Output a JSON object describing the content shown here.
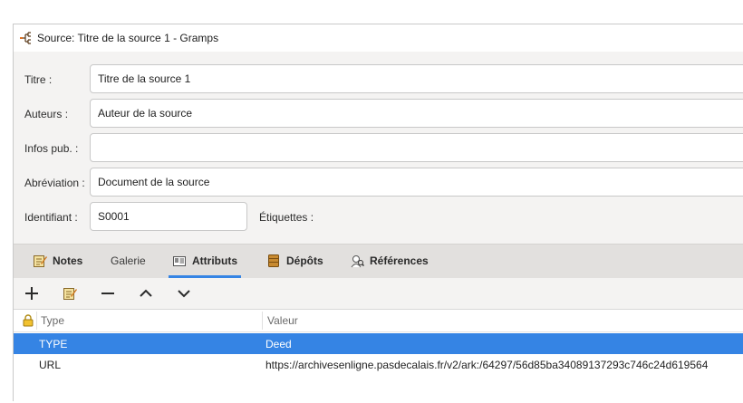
{
  "window": {
    "title": "Source: Titre de la source 1 - Gramps"
  },
  "form": {
    "title_label": "Titre :",
    "title_value": "Titre de la source 1",
    "author_label": "Auteurs :",
    "author_value": "Auteur de la source",
    "pubinfo_label": "Infos pub. :",
    "pubinfo_value": "",
    "abbrev_label": "Abréviation :",
    "abbrev_value": "Document de la source",
    "id_label": "Identifiant :",
    "id_value": "S0001",
    "tags_label": "Étiquettes :"
  },
  "tabs": [
    {
      "label": "Notes",
      "icon": "notes-icon"
    },
    {
      "label": "Galerie"
    },
    {
      "label": "Attributs",
      "icon": "attributes-icon",
      "active": true
    },
    {
      "label": "Dépôts",
      "icon": "repository-icon"
    },
    {
      "label": "Références",
      "icon": "references-icon"
    }
  ],
  "toolbar": {
    "add": "add-icon",
    "edit": "edit-icon",
    "remove": "remove-icon",
    "up": "arrow-up-icon",
    "down": "arrow-down-icon"
  },
  "table": {
    "headers": {
      "private": "lock-icon",
      "type": "Type",
      "value": "Valeur"
    },
    "rows": [
      {
        "type": "TYPE",
        "value": "Deed",
        "selected": true
      },
      {
        "type": "URL",
        "value": "https://archivesenligne.pasdecalais.fr/v2/ark:/64297/56d85ba34089137293c746c24d619564",
        "selected": false
      }
    ]
  },
  "colors": {
    "accent": "#3584e4",
    "window_bg": "#f4f3f2",
    "tabbar_bg": "#e2e0de"
  }
}
